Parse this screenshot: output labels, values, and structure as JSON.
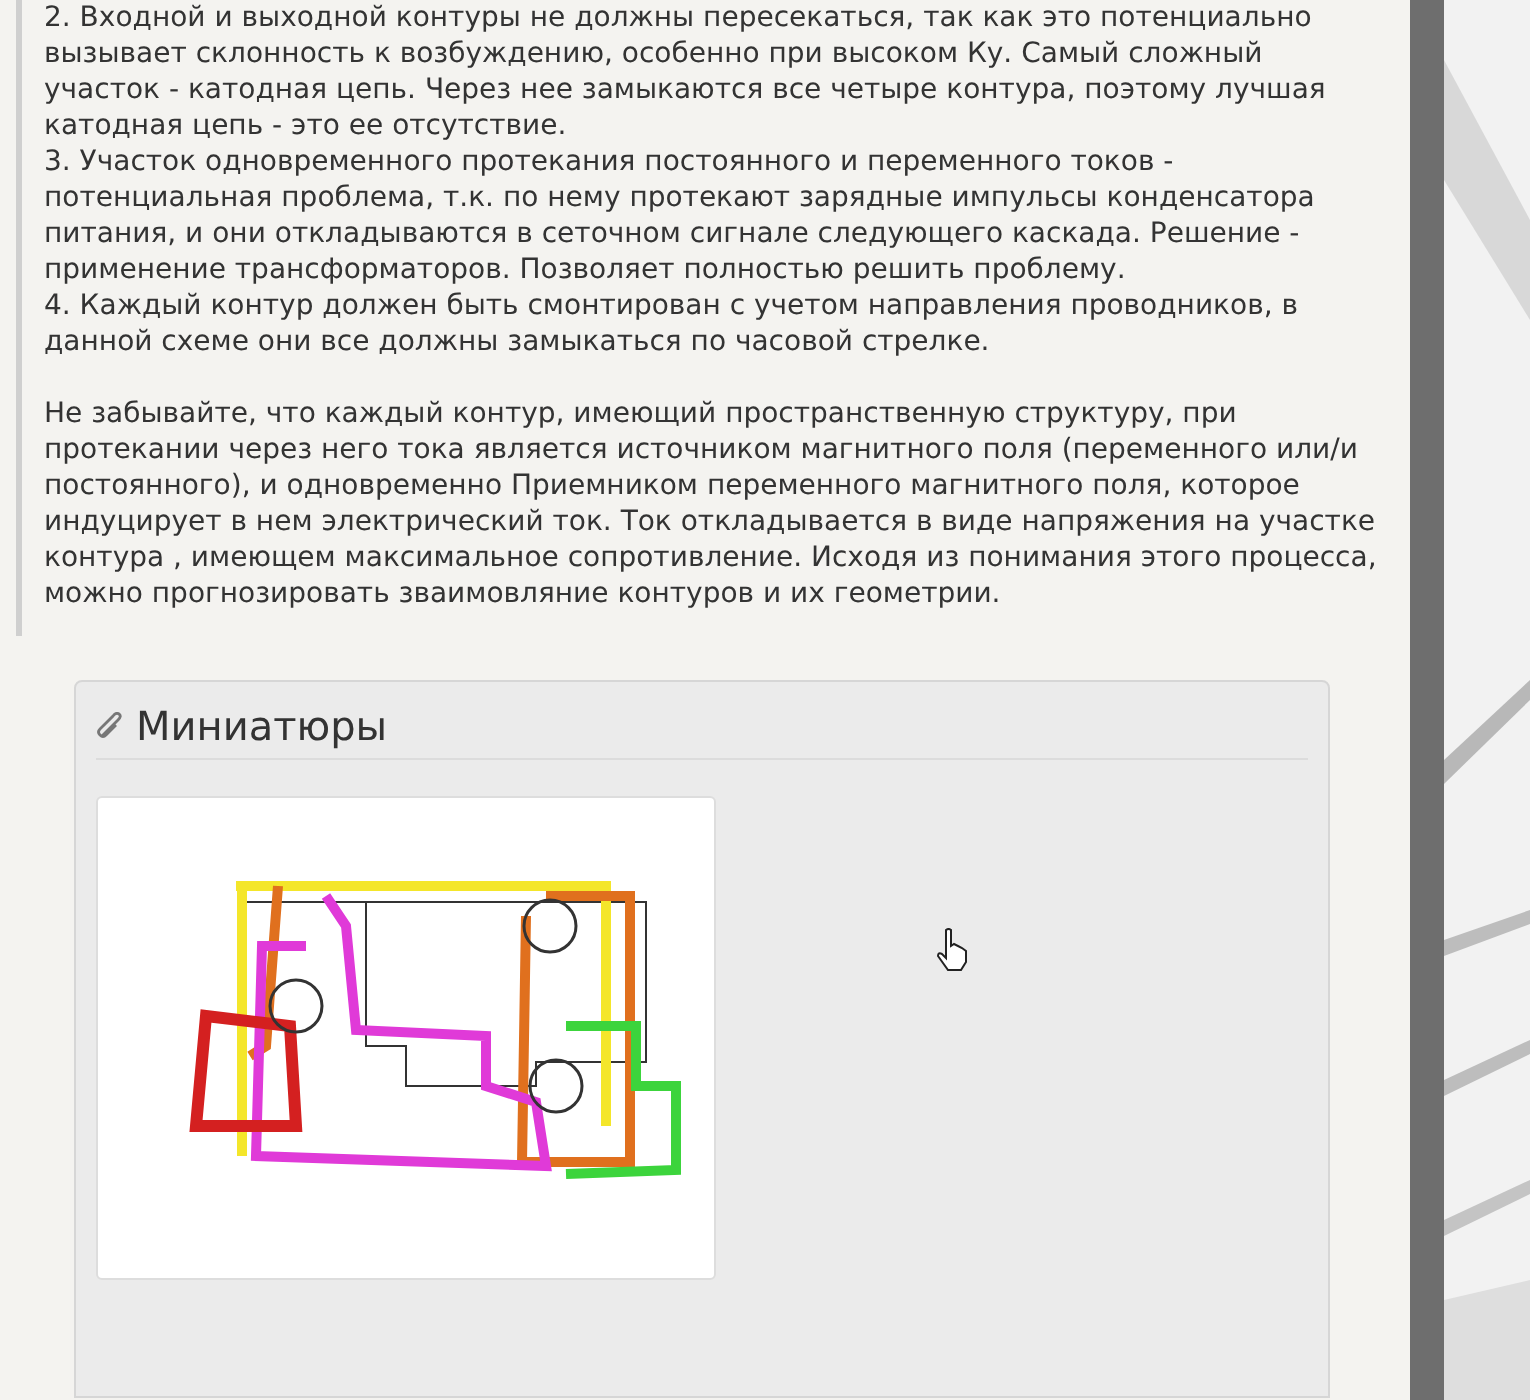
{
  "post": {
    "items": [
      "2. Входной и выходной контуры не должны пересекаться, так как это потенциально вызывает склонность к возбуждению, особенно при высоком Ку. Самый сложный участок - катодная цепь. Через нее замыкаются все четыре контура, поэтому лучшая катодная цепь - это ее отсутствие.",
      "3. Участок одновременного протекания постоянного и переменного токов - потенциальная проблема, т.к. по нему протекают зарядные импульсы конденсатора питания, и они откладываются в сеточном сигнале следующего каскада. Решение - применение трансформаторов. Позволяет полностью решить проблему.",
      "4. Каждый контур должен быть смонтирован с учетом направления проводников, в данной схеме они все должны замыкаться по часовой стрелке."
    ],
    "paragraph": "Не забывайте, что каждый контур, имеющий пространственную структуру, при протекании через него тока является источником магнитного поля (переменного или/и постоянного), и одновременно Приемником переменного магнитного поля, которое индуцирует в нем электрический ток. Ток откладывается в виде напряжения на участке контура , имеющем максимальное сопротивление. Исходя из понимания этого процесса, можно прогнозировать зваимовляние контуров и их геометрии."
  },
  "thumbnails": {
    "title": "Миниатюры"
  }
}
